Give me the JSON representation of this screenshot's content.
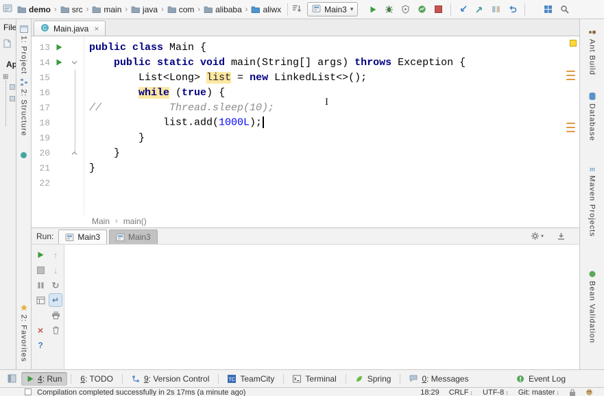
{
  "toolbar": {
    "nav_icon": "navigation-bar-icon",
    "breadcrumbs": [
      {
        "label": "demo",
        "icon": "folder-icon",
        "bold": true
      },
      {
        "label": "src",
        "icon": "folder-icon"
      },
      {
        "label": "main",
        "icon": "folder-icon"
      },
      {
        "label": "java",
        "icon": "folder-icon"
      },
      {
        "label": "com",
        "icon": "folder-icon"
      },
      {
        "label": "alibaba",
        "icon": "folder-icon"
      },
      {
        "label": "aliwx",
        "icon": "source-folder-icon"
      }
    ],
    "sort_icon": "sort-icon",
    "run_config": {
      "icon": "app-icon",
      "label": "Main3"
    },
    "actions": [
      "run-icon",
      "debug-icon",
      "coverage-icon",
      "profiler-icon",
      "stop-icon"
    ],
    "vcs_actions": [
      "update-project-icon",
      "commit-icon",
      "compare-icon",
      "undo-icon"
    ],
    "right_actions": [
      "project-structure-icon",
      "search-icon"
    ]
  },
  "background_window": {
    "menu": "File",
    "label": "Ap"
  },
  "left_strip": {
    "top": [
      {
        "icon": "project-tool-icon",
        "label": "1: Project"
      },
      {
        "icon": "structure-tool-icon",
        "label": "2: Structure"
      }
    ],
    "middle_icon": "pin-tool-icon",
    "bottom": [
      {
        "icon": "favorites-tool-icon",
        "label": "2: Favorites"
      }
    ]
  },
  "right_strip": [
    {
      "icon": "ant-build-icon",
      "label": "Ant Build"
    },
    {
      "icon": "database-icon",
      "label": "Database"
    },
    {
      "icon": "maven-icon",
      "label": "Maven Projects"
    },
    {
      "icon": "bean-validation-icon",
      "label": "Bean Validation"
    }
  ],
  "editor": {
    "tab": {
      "icon": "class-icon",
      "label": "Main.java",
      "close": "×"
    },
    "lines": [
      {
        "num": "13",
        "run": true,
        "fold": "",
        "tokens": [
          {
            "c": "k",
            "t": "public class"
          },
          {
            "c": "p",
            "t": " Main {"
          }
        ]
      },
      {
        "num": "14",
        "run": true,
        "fold": "open",
        "tokens": [
          {
            "c": "p",
            "t": "    "
          },
          {
            "c": "k",
            "t": "public static void "
          },
          {
            "c": "p",
            "t": "main(String[] args) "
          },
          {
            "c": "k",
            "t": "throws"
          },
          {
            "c": "p",
            "t": " Exception {"
          }
        ]
      },
      {
        "num": "15",
        "run": false,
        "fold": "",
        "tokens": [
          {
            "c": "p",
            "t": "        List<Long> "
          },
          {
            "c": "hl",
            "t": "list"
          },
          {
            "c": "p",
            "t": " = "
          },
          {
            "c": "k",
            "t": "new"
          },
          {
            "c": "p",
            "t": " LinkedList<>();"
          }
        ]
      },
      {
        "num": "16",
        "run": false,
        "fold": "",
        "tokens": [
          {
            "c": "p",
            "t": "        "
          },
          {
            "c": "khl",
            "t": "while"
          },
          {
            "c": "p",
            "t": " ("
          },
          {
            "c": "k",
            "t": "true"
          },
          {
            "c": "p",
            "t": ") {"
          }
        ]
      },
      {
        "num": "17",
        "run": false,
        "fold": "",
        "tokens": [
          {
            "c": "cmt",
            "t": "//           Thread.sleep(10);"
          }
        ]
      },
      {
        "num": "18",
        "run": false,
        "fold": "",
        "caret": true,
        "tokens": [
          {
            "c": "p",
            "t": "            list.add("
          },
          {
            "c": "num",
            "t": "1000L"
          },
          {
            "c": "p",
            "t": ");"
          }
        ]
      },
      {
        "num": "19",
        "run": false,
        "fold": "",
        "tokens": [
          {
            "c": "p",
            "t": "        }"
          }
        ]
      },
      {
        "num": "20",
        "run": false,
        "fold": "close",
        "tokens": [
          {
            "c": "p",
            "t": "    }"
          }
        ]
      },
      {
        "num": "21",
        "run": false,
        "fold": "",
        "tokens": [
          {
            "c": "p",
            "t": "}"
          }
        ]
      },
      {
        "num": "22",
        "run": false,
        "fold": "",
        "tokens": []
      }
    ],
    "breadcrumb": [
      "Main",
      "main()"
    ]
  },
  "run_panel": {
    "label": "Run:",
    "tabs": [
      {
        "icon": "app-icon",
        "label": "Main3",
        "active": true
      },
      {
        "icon": "app-icon",
        "label": "Main3",
        "active": false
      }
    ],
    "header_icons": [
      "settings-gear-icon",
      "hide-panel-icon"
    ],
    "tool_icons_left": [
      "rerun-icon",
      "stop-disabled-icon",
      "pause-icon",
      "restore-layout-icon",
      "",
      "close-tab-icon",
      "help-icon"
    ],
    "tool_icons_right": [
      "up-stack-icon",
      "down-stack-icon",
      "rerun-failed-icon",
      "softwrap-icon",
      "print-icon",
      "clear-all-icon",
      ""
    ]
  },
  "bottom_bar": {
    "switcher_icon": "tool-window-switcher-icon",
    "tabs": [
      {
        "icon": "run-small-icon",
        "key": "4",
        "text": ": Run",
        "active": true
      },
      {
        "icon": "",
        "key": "6",
        "text": ": TODO",
        "active": false
      },
      {
        "icon": "vcs-icon",
        "key": "9",
        "text": ": Version Control",
        "active": false
      },
      {
        "icon": "teamcity-icon",
        "key": "",
        "text": "TeamCity",
        "active": false
      },
      {
        "icon": "terminal-icon",
        "key": "",
        "text": "Terminal",
        "active": false
      },
      {
        "icon": "spring-icon",
        "key": "",
        "text": "Spring",
        "active": false
      },
      {
        "icon": "messages-icon",
        "key": "0",
        "text": ": Messages",
        "active": false
      }
    ],
    "event_log": {
      "icon": "event-log-icon",
      "text": "Event Log"
    }
  },
  "status_bar": {
    "task_icon": "status-square-icon",
    "message": "Compilation completed successfully in 2s 17ms (a minute ago)",
    "clock": "18:29",
    "items": [
      "CRLF",
      "UTF-8",
      "Git: master"
    ],
    "right_icons": [
      "lock-icon",
      "inspections-icon"
    ]
  }
}
